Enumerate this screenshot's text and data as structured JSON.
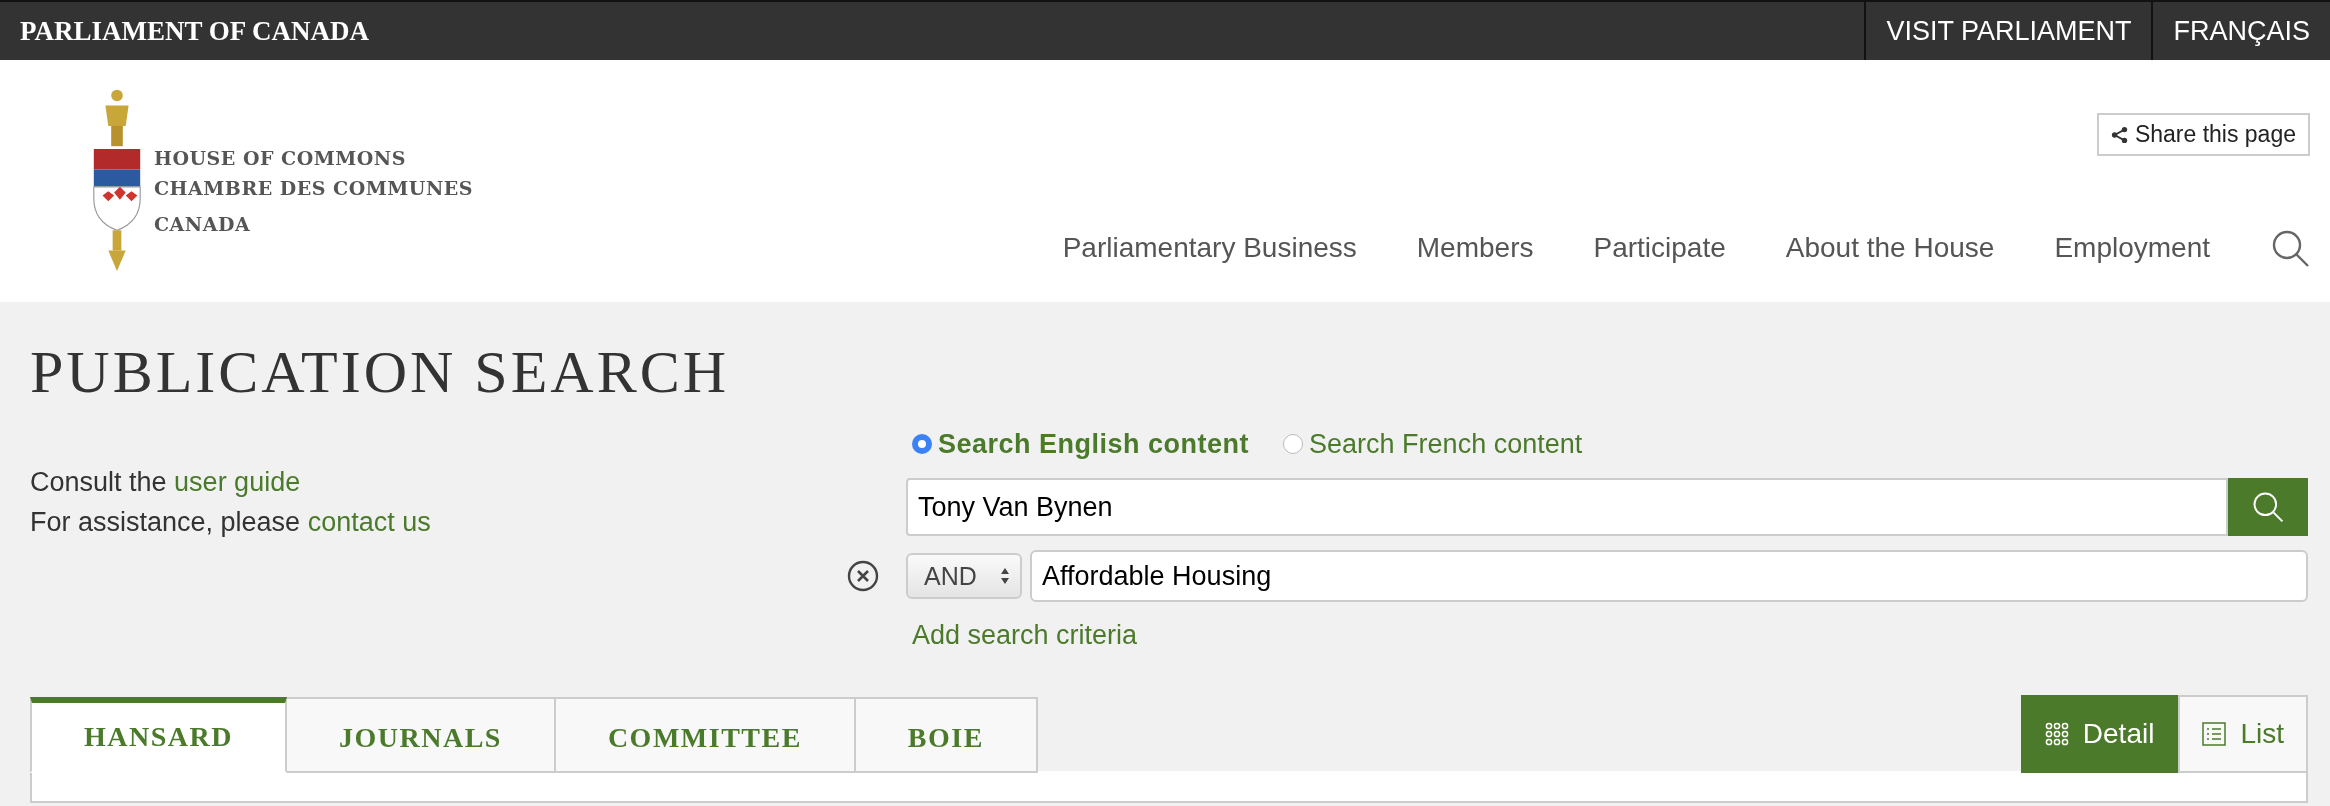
{
  "top_bar": {
    "title": "PARLIAMENT OF CANADA",
    "links": [
      "VISIT PARLIAMENT",
      "FRANÇAIS"
    ]
  },
  "header": {
    "logo_lines": [
      "HOUSE OF COMMONS",
      "CHAMBRE DES COMMUNES",
      "CANADA"
    ],
    "share_button": "Share this page",
    "nav": [
      "Parliamentary Business",
      "Members",
      "Participate",
      "About the House",
      "Employment"
    ]
  },
  "page": {
    "title": "PUBLICATION SEARCH",
    "help": [
      {
        "text": "Consult the",
        "link": "user guide"
      },
      {
        "text": "For assistance, please",
        "link": "contact us"
      }
    ],
    "language_options": [
      {
        "label": "Search English content",
        "selected": true
      },
      {
        "label": "Search French content",
        "selected": false
      }
    ],
    "query": {
      "value": "Tony Van Bynen"
    },
    "criteria": [
      {
        "operator": "AND",
        "value": "Affordable Housing"
      }
    ],
    "add_criteria": "Add search criteria",
    "tabs": [
      {
        "label": "HANSARD",
        "selected": true
      },
      {
        "label": "JOURNALS",
        "selected": false
      },
      {
        "label": "COMMITTEE",
        "selected": false
      },
      {
        "label": "BOIE",
        "selected": false
      }
    ],
    "views": [
      {
        "label": "Detail",
        "selected": true,
        "kind": "grid"
      },
      {
        "label": "List",
        "selected": false,
        "kind": "list"
      }
    ]
  }
}
